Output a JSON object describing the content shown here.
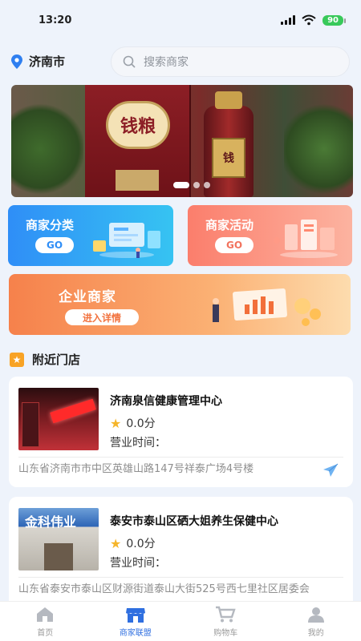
{
  "status": {
    "time": "13:20",
    "battery": "90"
  },
  "header": {
    "city": "济南市",
    "search_placeholder": "搜索商家"
  },
  "banner": {
    "box_text": "钱粮",
    "bottle_text": "钱",
    "page_count": 3,
    "active_page": 0
  },
  "cards": {
    "category": {
      "title": "商家分类",
      "go": "GO"
    },
    "activity": {
      "title": "商家活动",
      "go": "GO"
    }
  },
  "enterprise": {
    "title": "企业商家",
    "button": "进入详情"
  },
  "nearby": {
    "title": "附近门店"
  },
  "stores": [
    {
      "name": "济南泉信健康管理中心",
      "rating": "0.0分",
      "hours_label": "营业时间：",
      "address": "山东省济南市市中区英雄山路147号祥泰广场4号楼"
    },
    {
      "name": "泰安市泰山区硒大姐养生保健中心",
      "rating": "0.0分",
      "hours_label": "营业时间：",
      "address": "山东省泰安市泰山区财源街道泰山大街525号西七里社区居委会",
      "thumb_sign": "金科伟业"
    }
  ],
  "tabs": [
    {
      "label": "首页",
      "icon": "home-icon"
    },
    {
      "label": "商家联盟",
      "icon": "store-icon",
      "active": true
    },
    {
      "label": "购物车",
      "icon": "cart-icon"
    },
    {
      "label": "我的",
      "icon": "profile-icon"
    }
  ],
  "colors": {
    "accent": "#2f6fe0",
    "category": "#2f8ef7",
    "activity": "#fb7e6c",
    "enterprise": "#f6814b"
  }
}
